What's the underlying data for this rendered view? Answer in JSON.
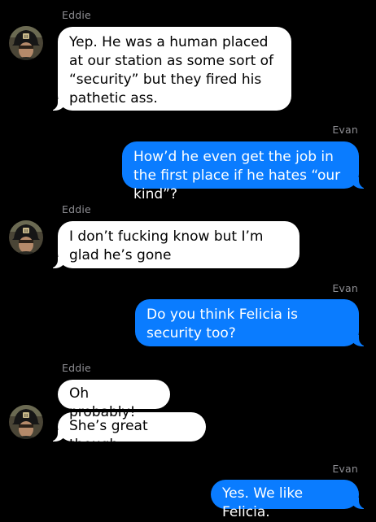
{
  "conversation": {
    "messages": [
      {
        "sender": "Eddie",
        "direction": "incoming",
        "text": "Yep. He was a human placed at our station as some sort of “security” but they fired his pathetic ass."
      },
      {
        "sender": "Evan",
        "direction": "outgoing",
        "text": "How’d he even get the job in the first place if he hates “our kind”?"
      },
      {
        "sender": "Eddie",
        "direction": "incoming",
        "text": "I don’t fucking know but I’m glad he’s gone"
      },
      {
        "sender": "Evan",
        "direction": "outgoing",
        "text": "Do you think Felicia is security too?"
      },
      {
        "sender": "Eddie",
        "direction": "incoming",
        "text": "Oh probably!"
      },
      {
        "sender": "Eddie",
        "direction": "incoming",
        "text": "She’s great though"
      },
      {
        "sender": "Evan",
        "direction": "outgoing",
        "text": "Yes. We like Felicia."
      }
    ]
  },
  "avatar": {
    "icon": "firefighter-avatar-photo",
    "helmet_badge": "III"
  },
  "colors": {
    "background": "#000000",
    "incoming_bubble": "#ffffff",
    "outgoing_bubble": "#0a7cff",
    "sender_name": "#8e8e93"
  }
}
